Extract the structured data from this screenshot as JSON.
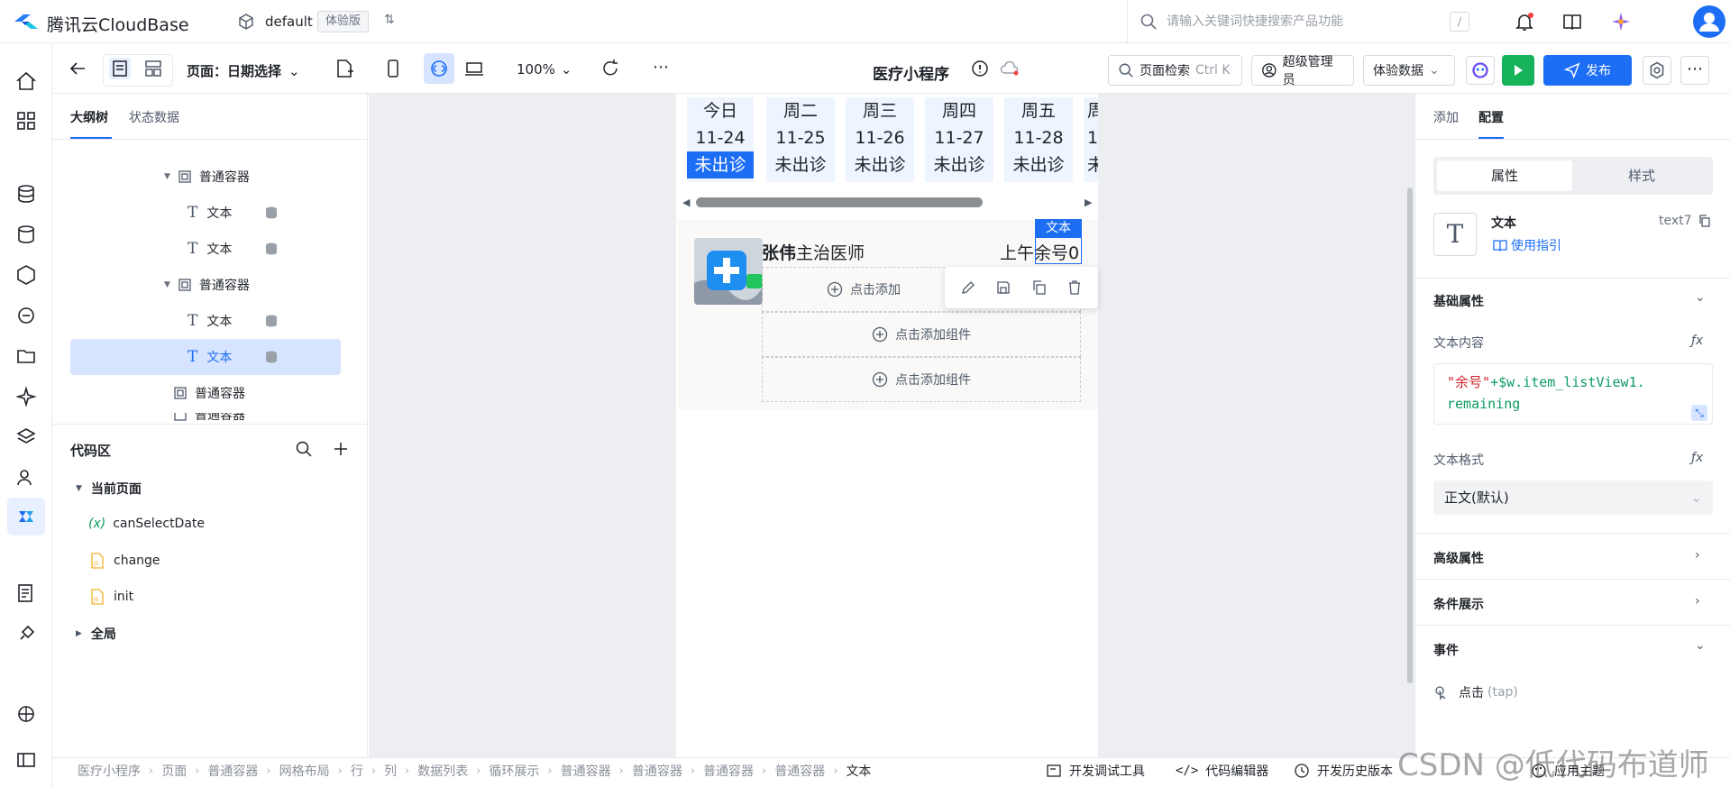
{
  "topbar": {
    "brand": "腾讯云CloudBase",
    "env_name": "default",
    "env_badge": "体验版",
    "search_placeholder": "请输入关键词快捷搜索产品功能",
    "search_shortcut": "/"
  },
  "toolbar": {
    "page_label": "页面：日期选择",
    "zoom": "100%",
    "app_title": "医疗小程序",
    "page_search_label": "页面检索",
    "page_search_shortcut": "Ctrl K",
    "admin_label": "超级管理员",
    "data_label": "体验数据",
    "publish_label": "发布"
  },
  "left_panel": {
    "tabs": [
      {
        "label": "大纲树"
      },
      {
        "label": "状态数据"
      }
    ],
    "tree": [
      {
        "label": "普通容器",
        "type": "container"
      },
      {
        "label": "文本",
        "type": "text"
      },
      {
        "label": "文本",
        "type": "text"
      },
      {
        "label": "普通容器",
        "type": "container"
      },
      {
        "label": "文本",
        "type": "text"
      },
      {
        "label": "文本",
        "type": "text",
        "selected": true
      },
      {
        "label": "普通容器",
        "type": "container"
      },
      {
        "label": "普通容器",
        "type": "container"
      }
    ],
    "code_title": "代码区",
    "code_current": "当前页面",
    "code_items": [
      {
        "label": "canSelectDate",
        "kind": "variable"
      },
      {
        "label": "change",
        "kind": "js-file"
      },
      {
        "label": "init",
        "kind": "js-file"
      }
    ],
    "code_global": "全局"
  },
  "canvas": {
    "days": [
      {
        "weekday": "今日",
        "date": "11-24",
        "status": "未出诊",
        "today": true
      },
      {
        "weekday": "周二",
        "date": "11-25",
        "status": "未出诊"
      },
      {
        "weekday": "周三",
        "date": "11-26",
        "status": "未出诊"
      },
      {
        "weekday": "周四",
        "date": "11-27",
        "status": "未出诊"
      },
      {
        "weekday": "周五",
        "date": "11-28",
        "status": "未出诊"
      },
      {
        "weekday": "周",
        "date": "1",
        "status": "未"
      }
    ],
    "doctor_name": "张伟",
    "doctor_title": "主治医师",
    "slot_period": "上午",
    "slot_remaining": "余号0",
    "selection_label": "文本",
    "add_component_label": "点击添加组件",
    "add_component_partial": "点击添加"
  },
  "right_panel": {
    "tabs": [
      {
        "label": "添加"
      },
      {
        "label": "配置"
      }
    ],
    "segments": [
      {
        "label": "属性"
      },
      {
        "label": "样式"
      }
    ],
    "component_name": "文本",
    "component_guide": "使用指引",
    "component_id": "text7",
    "component_icon_glyph": "T",
    "basic_title": "基础属性",
    "text_content_label": "文本内容",
    "expr_str": "\"余号\"",
    "expr_rest": "+$w.item_listView1.",
    "expr_rest2": "remaining",
    "text_format_label": "文本格式",
    "text_format_value": "正文(默认)",
    "fx_label": "ƒx",
    "advanced_title": "高级属性",
    "condition_title": "条件展示",
    "events_title": "事件",
    "event_tap": "点击",
    "event_tap_code": "(tap)"
  },
  "bottombar": {
    "breadcrumb": [
      "医疗小程序",
      "页面",
      "普通容器",
      "网格布局",
      "行",
      "列",
      "数据列表",
      "循环展示",
      "普通容器",
      "普通容器",
      "普通容器",
      "普通容器",
      "文本"
    ],
    "dev_tools": "开发调试工具",
    "code_editor": "代码编辑器",
    "history": "开发历史版本",
    "theme": "应用主题"
  },
  "watermark": "CSDN @低代码布道师",
  "colors": {
    "accent": "#1d6ef5",
    "run": "#16b35b",
    "selected_row": "#d6e4ff"
  }
}
